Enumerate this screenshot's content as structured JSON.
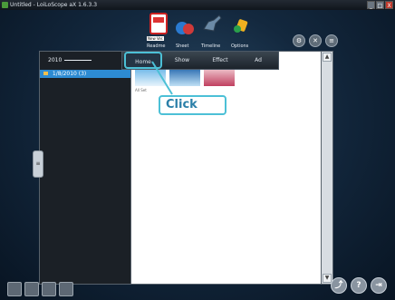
{
  "window": {
    "title": "Untitled - LoiLoScope aX 1.6.3.3",
    "min_label": "_",
    "max_label": "□",
    "close_label": "X"
  },
  "top_nav": {
    "items": [
      {
        "label": "Readme",
        "icon": "readme-icon"
      },
      {
        "label": "Sheet",
        "icon": "balloons-icon"
      },
      {
        "label": "Timeline",
        "icon": "dinosaur-icon"
      },
      {
        "label": "Options",
        "icon": "tools-icon"
      }
    ],
    "badge": "New Ver."
  },
  "tools": {
    "icons": [
      "settings-icon",
      "close-icon",
      "list-icon"
    ]
  },
  "ribbon": {
    "tabs": [
      {
        "label": "Home",
        "active": true
      },
      {
        "label": "Show",
        "active": false
      },
      {
        "label": "Effect",
        "active": false
      },
      {
        "label": "Ad",
        "active": false
      }
    ]
  },
  "sidebar": {
    "year": "2010",
    "items": [
      {
        "label": "1/8/2010 (3)",
        "selected": true
      }
    ]
  },
  "content": {
    "caption": "All Set"
  },
  "annotation": {
    "label": "Click"
  },
  "side_handle": {
    "label": "≡"
  },
  "scroll": {
    "up": "▲",
    "down": "▼"
  },
  "bottom_left_icons": [
    "edit-icon",
    "palette-icon",
    "film-icon",
    "image-icon"
  ],
  "bottom_right": {
    "help_label": "?",
    "misc_label": "⇥"
  },
  "colors": {
    "accent": "#4cc0d6",
    "selected": "#2d8bd3"
  }
}
